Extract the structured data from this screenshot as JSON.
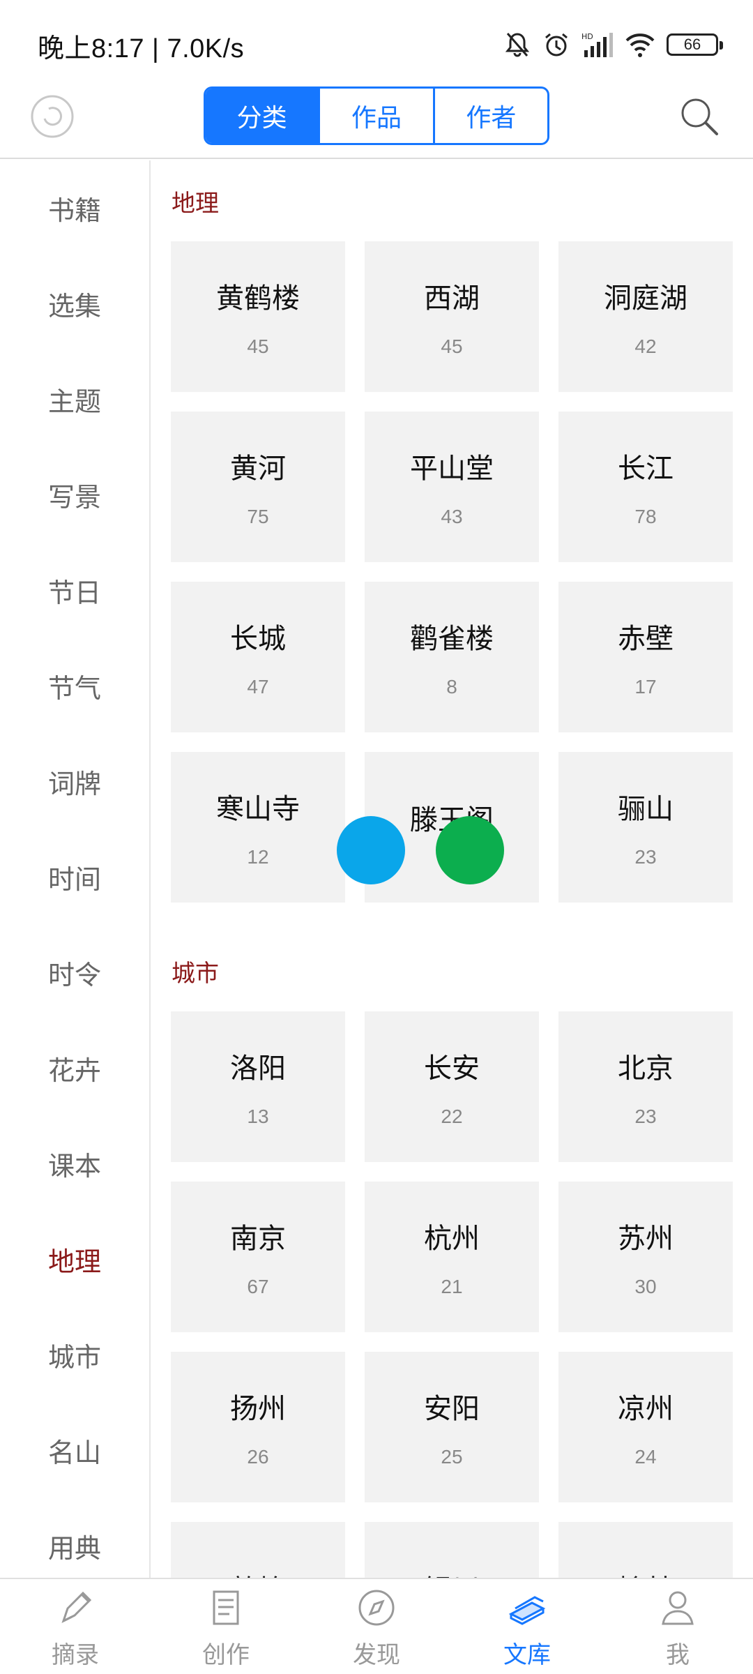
{
  "status_bar": {
    "time_speed": "晚上8:17 | 7.0K/s",
    "battery": "66"
  },
  "top_bar": {
    "tabs": [
      {
        "label": "分类",
        "active": true
      },
      {
        "label": "作品",
        "active": false
      },
      {
        "label": "作者",
        "active": false
      }
    ]
  },
  "sidebar": {
    "items": [
      {
        "label": "书籍"
      },
      {
        "label": "选集"
      },
      {
        "label": "主题"
      },
      {
        "label": "写景"
      },
      {
        "label": "节日"
      },
      {
        "label": "节气"
      },
      {
        "label": "词牌"
      },
      {
        "label": "时间"
      },
      {
        "label": "时令"
      },
      {
        "label": "花卉"
      },
      {
        "label": "课本"
      },
      {
        "label": "地理",
        "active": true
      },
      {
        "label": "城市"
      },
      {
        "label": "名山"
      },
      {
        "label": "用典"
      }
    ]
  },
  "sections": [
    {
      "title": "地理",
      "tiles": [
        {
          "name": "黄鹤楼",
          "count": "45"
        },
        {
          "name": "西湖",
          "count": "45"
        },
        {
          "name": "洞庭湖",
          "count": "42"
        },
        {
          "name": "黄河",
          "count": "75"
        },
        {
          "name": "平山堂",
          "count": "43"
        },
        {
          "name": "长江",
          "count": "78"
        },
        {
          "name": "长城",
          "count": "47"
        },
        {
          "name": "鹳雀楼",
          "count": "8"
        },
        {
          "name": "赤壁",
          "count": "17"
        },
        {
          "name": "寒山寺",
          "count": "12"
        },
        {
          "name": "滕王阁",
          "count": ""
        },
        {
          "name": "骊山",
          "count": "23"
        }
      ]
    },
    {
      "title": "城市",
      "tiles": [
        {
          "name": "洛阳",
          "count": "13"
        },
        {
          "name": "长安",
          "count": "22"
        },
        {
          "name": "北京",
          "count": "23"
        },
        {
          "name": "南京",
          "count": "67"
        },
        {
          "name": "杭州",
          "count": "21"
        },
        {
          "name": "苏州",
          "count": "30"
        },
        {
          "name": "扬州",
          "count": "26"
        },
        {
          "name": "安阳",
          "count": "25"
        },
        {
          "name": "凉州",
          "count": "24"
        },
        {
          "name": "敦煌",
          "count": ""
        },
        {
          "name": "银川",
          "count": ""
        },
        {
          "name": "榆林",
          "count": ""
        }
      ]
    }
  ],
  "bottom_nav": {
    "items": [
      {
        "label": "摘录",
        "icon": "pen-icon"
      },
      {
        "label": "创作",
        "icon": "document-icon"
      },
      {
        "label": "发现",
        "icon": "compass-icon"
      },
      {
        "label": "文库",
        "icon": "books-icon",
        "active": true
      },
      {
        "label": "我",
        "icon": "person-icon"
      }
    ]
  },
  "colors": {
    "accent": "#1677ff",
    "active_category": "#8b1a1a",
    "tile_bg": "#f2f2f2",
    "dot_blue": "#0aa6ea",
    "dot_green": "#0cae4e"
  }
}
